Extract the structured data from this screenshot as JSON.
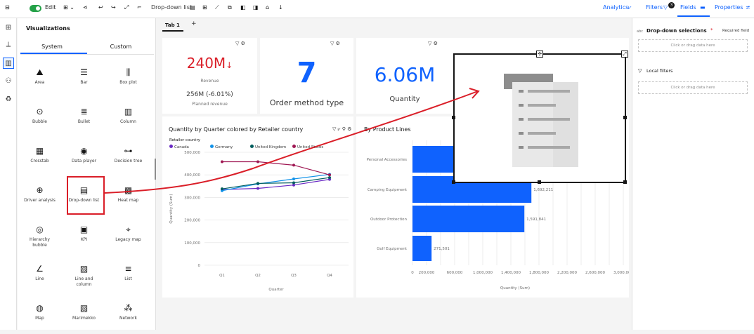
{
  "toolbar": {
    "edit_label": "Edit",
    "dropdown_list_label": "Drop-down list",
    "analytics_label": "Analytics",
    "filters_label": "Filters",
    "filters_count": "3",
    "fields_label": "Fields",
    "properties_label": "Properties"
  },
  "viz_panel": {
    "title": "Visualizations",
    "tab_system": "System",
    "tab_custom": "Custom",
    "tiles": [
      {
        "label": "Area",
        "icon": "area-icon",
        "glyph": "⛰"
      },
      {
        "label": "Bar",
        "icon": "bar-icon",
        "glyph": "☰"
      },
      {
        "label": "Box plot",
        "icon": "box-plot-icon",
        "glyph": "⫼"
      },
      {
        "label": "Bubble",
        "icon": "bubble-icon",
        "glyph": "⊙"
      },
      {
        "label": "Bullet",
        "icon": "bullet-icon",
        "glyph": "≣"
      },
      {
        "label": "Column",
        "icon": "column-icon",
        "glyph": "▥"
      },
      {
        "label": "Crosstab",
        "icon": "crosstab-icon",
        "glyph": "▦"
      },
      {
        "label": "Data player",
        "icon": "data-player-icon",
        "glyph": "◉"
      },
      {
        "label": "Decision tree",
        "icon": "decision-tree-icon",
        "glyph": "⊶"
      },
      {
        "label": "Driver analysis",
        "icon": "driver-analysis-icon",
        "glyph": "⊕"
      },
      {
        "label": "Drop-down list",
        "icon": "dropdown-list-icon",
        "glyph": "▤"
      },
      {
        "label": "Heat map",
        "icon": "heat-map-icon",
        "glyph": "▩"
      },
      {
        "label": "Hierarchy bubble",
        "icon": "hierarchy-bubble-icon",
        "glyph": "◎"
      },
      {
        "label": "KPI",
        "icon": "kpi-icon",
        "glyph": "▣"
      },
      {
        "label": "Legacy map",
        "icon": "legacy-map-icon",
        "glyph": "⌖"
      },
      {
        "label": "Line",
        "icon": "line-icon",
        "glyph": "∠"
      },
      {
        "label": "Line and column",
        "icon": "line-column-icon",
        "glyph": "▨"
      },
      {
        "label": "List",
        "icon": "list-icon",
        "glyph": "≡"
      },
      {
        "label": "Map",
        "icon": "map-icon",
        "glyph": "◍"
      },
      {
        "label": "Marimekko",
        "icon": "marimekko-icon",
        "glyph": "▧"
      },
      {
        "label": "Network",
        "icon": "network-icon",
        "glyph": "⁂"
      }
    ]
  },
  "canvas": {
    "tab_label": "Tab 1",
    "add_tab": "+"
  },
  "kpi1": {
    "value": "240M",
    "arrow": "↓",
    "caption": "Revenue",
    "sub_value": "256M (-6.01%)",
    "sub_caption": "Planned revenue"
  },
  "kpi2": {
    "value": "7",
    "caption": "Order method type"
  },
  "kpi3": {
    "value": "6.06M",
    "caption": "Quantity"
  },
  "colors": {
    "accent": "#0f62fe",
    "negative": "#da1e28",
    "bar": "#0f62fe",
    "highlight": "#da1e28"
  },
  "line_chart": {
    "title": "Quantity by Quarter colored by Retailer country",
    "legend_title": "Retailer country",
    "xlabel": "Quarter",
    "ylabel": "Quantity (Sum)",
    "chart_data": {
      "type": "line",
      "categories": [
        "Q1",
        "Q2",
        "Q3",
        "Q4"
      ],
      "ylim": [
        0,
        500000
      ],
      "yticks": [
        "0",
        "100,000",
        "200,000",
        "300,000",
        "400,000",
        "500,000"
      ],
      "series": [
        {
          "name": "Canada",
          "color": "#6929c4",
          "values": [
            335000,
            340000,
            355000,
            380000
          ]
        },
        {
          "name": "Germany",
          "color": "#1192e8",
          "values": [
            330000,
            360000,
            382000,
            402000
          ]
        },
        {
          "name": "United Kingdom",
          "color": "#005d5d",
          "values": [
            338000,
            362000,
            365000,
            388000
          ]
        },
        {
          "name": "United States",
          "color": "#9f1853",
          "values": [
            458000,
            458000,
            443000,
            400000
          ]
        }
      ]
    }
  },
  "bar_chart": {
    "title": "By Product Lines",
    "xlabel": "Quantity (Sum)",
    "chart_data": {
      "type": "bar",
      "categories": [
        "Personal Accessories",
        "Camping Equipment",
        "Outdoor Protection",
        "Golf Equipment"
      ],
      "values": [
        1750000,
        1692211,
        1591841,
        271501
      ],
      "value_labels": [
        "",
        "1,692,211",
        "1,591,841",
        "271,501"
      ],
      "xlim": [
        0,
        3000000
      ],
      "xticks": [
        "0",
        "200,000",
        "600,000",
        "1,000,000",
        "1,400,000",
        "1,800,000",
        "2,200,000",
        "2,600,000",
        "3,000,000"
      ]
    }
  },
  "fields_panel": {
    "dropdown_title": "Drop-down selections",
    "required_mark": "*",
    "required_label": "Required field",
    "placeholder1": "Click or drag data here",
    "local_filters": "Local filters",
    "placeholder2": "Click or drag data here"
  }
}
